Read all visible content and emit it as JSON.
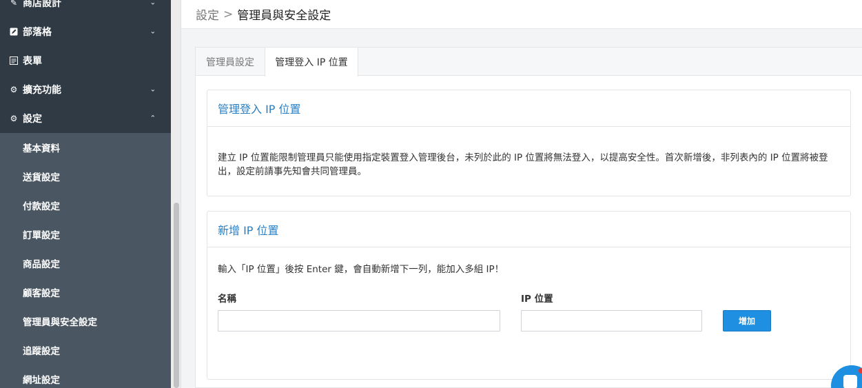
{
  "sidebar": {
    "top_items": [
      {
        "label": "商店設計",
        "icon": "pencil-icon",
        "chevron": "⌄"
      },
      {
        "label": "部落格",
        "icon": "edit-icon",
        "chevron": "⌄"
      },
      {
        "label": "表單",
        "icon": "form-icon",
        "chevron": ""
      },
      {
        "label": "擴充功能",
        "icon": "gears-icon",
        "chevron": "⌄"
      },
      {
        "label": "設定",
        "icon": "gear-icon",
        "chevron": "⌃"
      }
    ],
    "sub_items": [
      {
        "label": "基本資料"
      },
      {
        "label": "送貨設定"
      },
      {
        "label": "付款設定"
      },
      {
        "label": "訂單設定"
      },
      {
        "label": "商品設定"
      },
      {
        "label": "顧客設定"
      },
      {
        "label": "管理員與安全設定"
      },
      {
        "label": "追蹤設定"
      },
      {
        "label": "網址設定"
      }
    ]
  },
  "breadcrumb": {
    "parent": "設定",
    "separator": ">",
    "current": "管理員與安全設定"
  },
  "tabs": [
    {
      "label": "管理員設定",
      "active": false
    },
    {
      "label": "管理登入 IP 位置",
      "active": true
    }
  ],
  "info_card": {
    "title": "管理登入 IP 位置",
    "description": "建立 IP 位置能限制管理員只能使用指定裝置登入管理後台，未列於此的 IP 位置將無法登入，以提高安全性。首次新增後，非列表內的 IP 位置將被登出，設定前請事先知會共同管理員。"
  },
  "add_card": {
    "title": "新增 IP 位置",
    "hint": "輸入「IP 位置」後按 Enter 鍵，會自動新增下一列，能加入多組 IP！",
    "name_label": "名稱",
    "ip_label": "IP 位置",
    "name_value": "",
    "ip_value": "",
    "add_button": "增加"
  },
  "colors": {
    "sidebar_bg": "#2f3a45",
    "sidebar_sub_bg": "#4a5763",
    "accent": "#1e8fe1",
    "card_title": "#2a7fc3"
  }
}
